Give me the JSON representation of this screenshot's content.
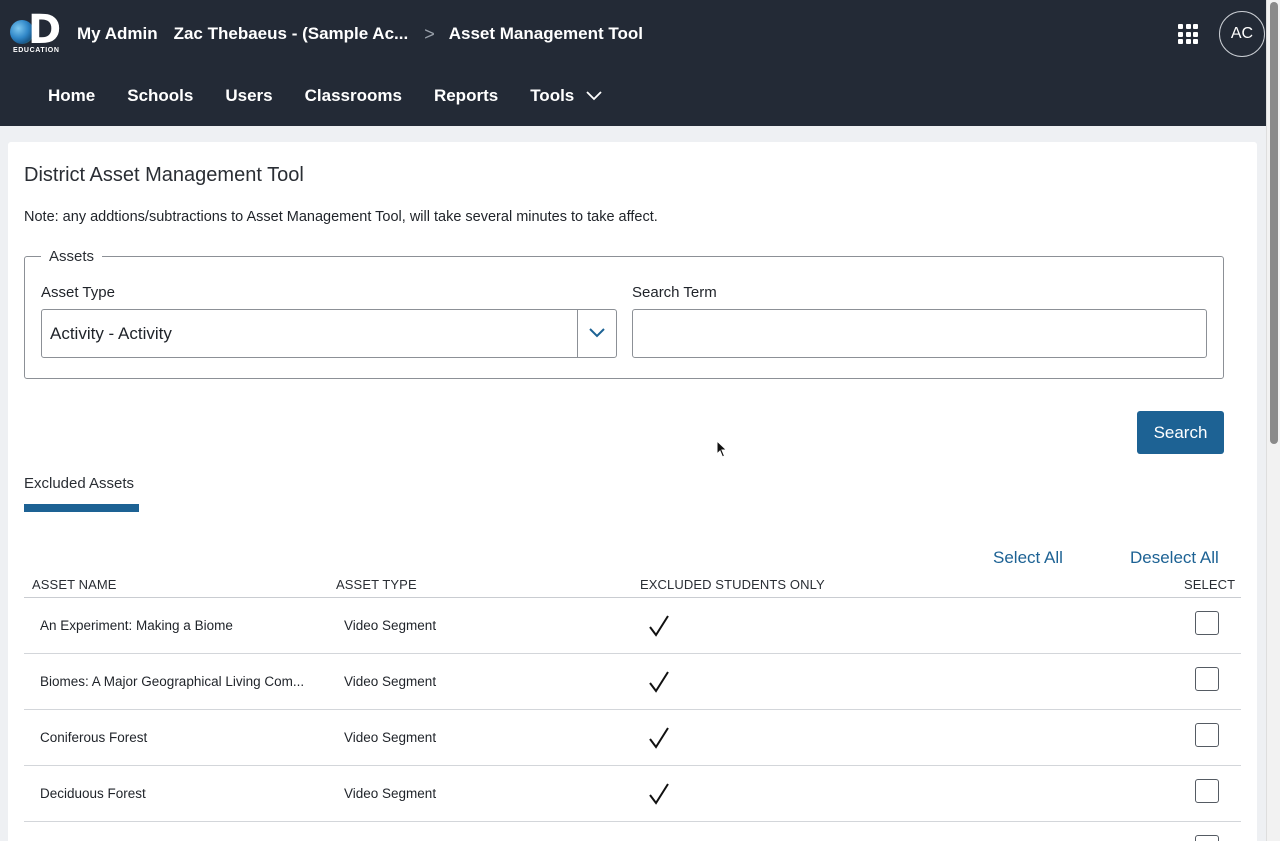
{
  "header": {
    "logo_text": "EDUCATION",
    "app_title": "My Admin",
    "account": "Zac Thebaeus - (Sample Ac...",
    "current_page": "Asset Management Tool",
    "avatar_initials": "AC"
  },
  "nav": {
    "items": [
      {
        "label": "Home"
      },
      {
        "label": "Schools"
      },
      {
        "label": "Users"
      },
      {
        "label": "Classrooms"
      },
      {
        "label": "Reports"
      },
      {
        "label": "Tools"
      }
    ]
  },
  "page": {
    "title": "District Asset Management Tool",
    "note": "Note: any addtions/subtractions to Asset Management Tool, will take several minutes to take affect."
  },
  "assets": {
    "legend": "Assets",
    "asset_type_label": "Asset Type",
    "asset_type_value": "Activity - Activity",
    "search_term_label": "Search Term",
    "search_term_value": "",
    "search_button": "Search"
  },
  "excluded": {
    "tab_label": "Excluded Assets",
    "select_all": "Select All",
    "deselect_all": "Deselect All",
    "columns": {
      "name": "ASSET NAME",
      "type": "ASSET TYPE",
      "excluded": "EXCLUDED STUDENTS ONLY",
      "select": "SELECT"
    },
    "rows": [
      {
        "name": "An Experiment: Making a Biome",
        "type": "Video Segment",
        "excluded_students_only": true,
        "selected": false
      },
      {
        "name": "Biomes: A Major Geographical Living Com...",
        "type": "Video Segment",
        "excluded_students_only": true,
        "selected": false
      },
      {
        "name": "Coniferous Forest",
        "type": "Video Segment",
        "excluded_students_only": true,
        "selected": false
      },
      {
        "name": "Deciduous Forest",
        "type": "Video Segment",
        "excluded_students_only": true,
        "selected": false
      }
    ]
  },
  "colors": {
    "header_bg": "#232a36",
    "accent": "#1d6294",
    "page_bg": "#eef0f3"
  }
}
